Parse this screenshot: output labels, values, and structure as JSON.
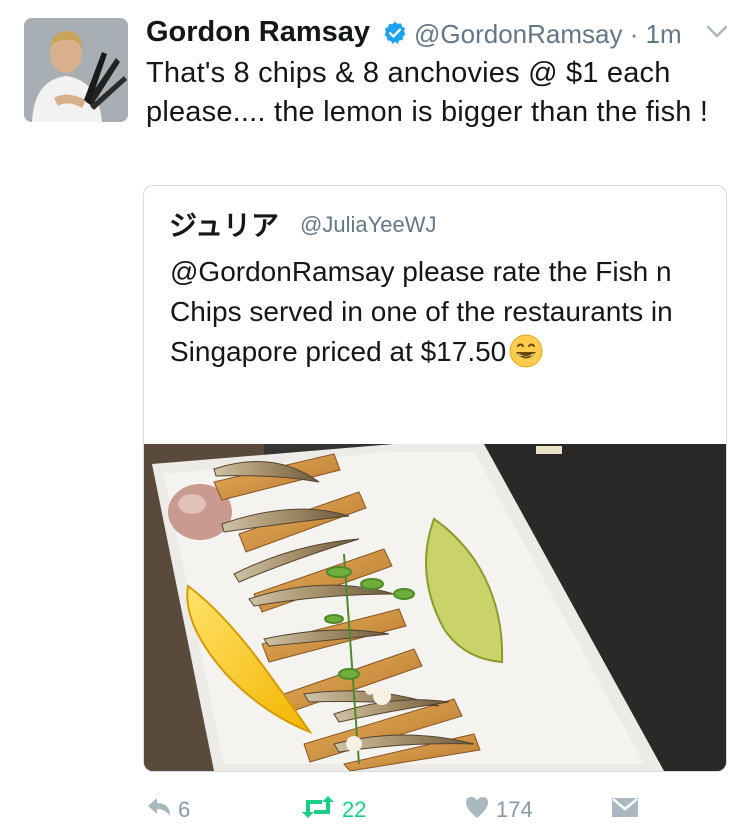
{
  "tweet": {
    "author_name": "Gordon Ramsay",
    "handle": "@GordonRamsay",
    "time": "· 1m",
    "text": "That's 8 chips & 8 anchovies @ $1 each please.... the lemon is bigger than the fish !"
  },
  "quoted": {
    "author_name": "ジュリア",
    "handle": "@JuliaYeeWJ",
    "text": "@GordonRamsay please rate the Fish n Chips served in one of the restaurants in Singapore priced at $17.50"
  },
  "actions": {
    "reply_count": "6",
    "retweet_count": "22",
    "like_count": "174"
  },
  "colors": {
    "verified_blue": "#1da1f2",
    "retweet_green": "#19cf86",
    "secondary_gray": "#657786",
    "action_gray": "#8899a6"
  },
  "icons": [
    "verified-icon",
    "caret-down-icon",
    "smile-emoji-icon",
    "reply-icon",
    "retweet-icon",
    "like-icon",
    "direct-message-icon"
  ]
}
